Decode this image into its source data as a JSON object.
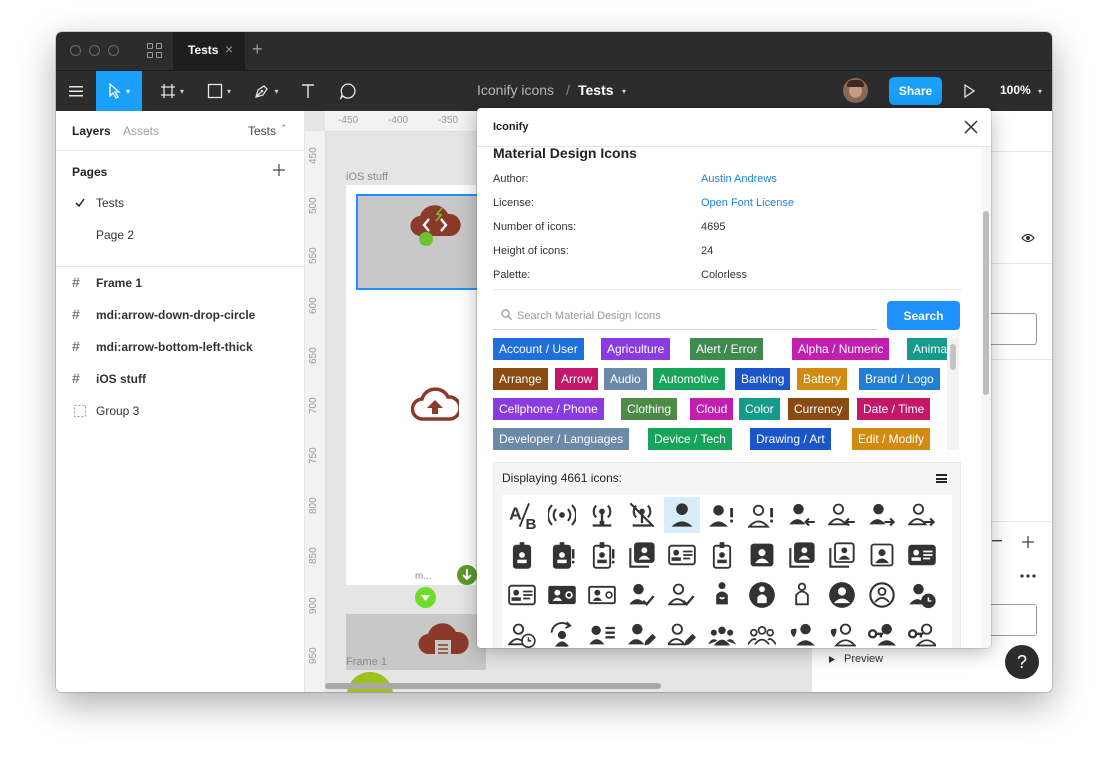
{
  "titlebar": {
    "tab_label": "Tests",
    "tab_close": "×",
    "new_tab": "+"
  },
  "toolbar": {
    "breadcrumb_project": "Iconify icons",
    "breadcrumb_sep": "/",
    "breadcrumb_file": "Tests",
    "share_label": "Share",
    "zoom_label": "100%"
  },
  "sidebar": {
    "tab_layers": "Layers",
    "tab_assets": "Assets",
    "page_selector": "Tests",
    "pages_header": "Pages",
    "pages": [
      {
        "label": "Tests",
        "checked": true
      },
      {
        "label": "Page 2",
        "checked": false
      }
    ],
    "layers": [
      {
        "label": "Frame 1",
        "icon": "frame-icon"
      },
      {
        "label": "mdi:arrow-down-drop-circle",
        "icon": "frame-icon"
      },
      {
        "label": "mdi:arrow-bottom-left-thick",
        "icon": "frame-icon"
      },
      {
        "label": "iOS stuff",
        "icon": "frame-icon"
      },
      {
        "label": "Group 3",
        "icon": "group-icon"
      }
    ]
  },
  "canvas": {
    "ruler_top": [
      "-450",
      "-400",
      "-350"
    ],
    "ruler_left": [
      "450",
      "500",
      "550",
      "600",
      "650",
      "700",
      "750",
      "800",
      "850",
      "900",
      "950"
    ],
    "label_ios": "iOS stuff",
    "label_frame1": "Frame 1",
    "label_m": "m..."
  },
  "right_panel": {
    "preview_label": "Preview"
  },
  "modal": {
    "title": "Iconify",
    "collection_name": "Material Design Icons",
    "info": [
      {
        "label": "Author:",
        "value": "Austin Andrews",
        "link": true
      },
      {
        "label": "License:",
        "value": "Open Font License",
        "link": true
      },
      {
        "label": "Number of icons:",
        "value": "4695",
        "link": false
      },
      {
        "label": "Height of icons:",
        "value": "24",
        "link": false
      },
      {
        "label": "Palette:",
        "value": "Colorless",
        "link": false
      }
    ],
    "search_placeholder": "Search Material Design Icons",
    "search_button": "Search",
    "categories": [
      [
        {
          "label": "Account / User",
          "color": "#1e6fd9"
        },
        {
          "label": "Agriculture",
          "color": "#8a3be0"
        },
        {
          "label": "Alert / Error",
          "color": "#3f8a4f"
        },
        {
          "label": "Alpha / Numeric",
          "color": "#c21fb0"
        },
        {
          "label": "Animal",
          "color": "#169a8c"
        }
      ],
      [
        {
          "label": "Arrange",
          "color": "#8a4b12"
        },
        {
          "label": "Arrow",
          "color": "#c4166a"
        },
        {
          "label": "Audio",
          "color": "#6b89a8"
        },
        {
          "label": "Automotive",
          "color": "#17a35a"
        },
        {
          "label": "Banking",
          "color": "#1c55c7"
        },
        {
          "label": "Battery",
          "color": "#d38a12"
        },
        {
          "label": "Brand / Logo",
          "color": "#1f7fd4"
        }
      ],
      [
        {
          "label": "Cellphone / Phone",
          "color": "#8a3be0"
        },
        {
          "label": "Clothing",
          "color": "#4d8a45"
        },
        {
          "label": "Cloud",
          "color": "#c21fb0"
        },
        {
          "label": "Color",
          "color": "#169a8c"
        },
        {
          "label": "Currency",
          "color": "#8a4b12"
        },
        {
          "label": "Date / Time",
          "color": "#c4166a"
        }
      ],
      [
        {
          "label": "Developer / Languages",
          "color": "#6b89a8"
        },
        {
          "label": "Device / Tech",
          "color": "#17a35a"
        },
        {
          "label": "Drawing / Art",
          "color": "#1c55c7"
        },
        {
          "label": "Edit / Modify",
          "color": "#d38a12"
        }
      ]
    ],
    "displaying_text": "Displaying 4661 icons:",
    "icon_rows": [
      [
        "ab-testing-icon",
        "access-point-icon",
        "access-point-network-icon",
        "access-point-network-off-icon",
        "account-icon",
        "account-alert-icon",
        "account-alert-outline-icon",
        "account-arrow-left-icon",
        "account-arrow-left-outline-icon",
        "account-arrow-right-icon",
        "account-arrow-right-outline-icon"
      ],
      [
        "account-badge-icon",
        "account-badge-alert-icon",
        "account-badge-alert-outline-icon",
        "account-box-multiple-icon",
        "account-badge-horizontal-outline-icon",
        "account-badge-outline-icon",
        "account-box-icon",
        "account-box-multiple-alt-icon",
        "account-box-multiple-outline-icon",
        "account-box-outline-icon",
        "account-card-details-icon"
      ],
      [
        "account-card-details-outline-icon",
        "account-cash-icon",
        "account-cash-outline-icon",
        "account-check-icon",
        "account-check-outline-icon",
        "account-child-icon",
        "account-child-circle-icon",
        "account-child-outline-icon",
        "account-circle-icon",
        "account-circle-outline-icon",
        "account-clock-icon"
      ],
      [
        "account-clock-outline-icon",
        "account-convert-icon",
        "account-details-icon",
        "account-edit-icon",
        "account-edit-outline-icon",
        "account-group-icon",
        "account-group-outline-icon",
        "account-heart-icon",
        "account-heart-outline-icon",
        "account-key-icon",
        "account-key-outline-icon"
      ]
    ]
  }
}
